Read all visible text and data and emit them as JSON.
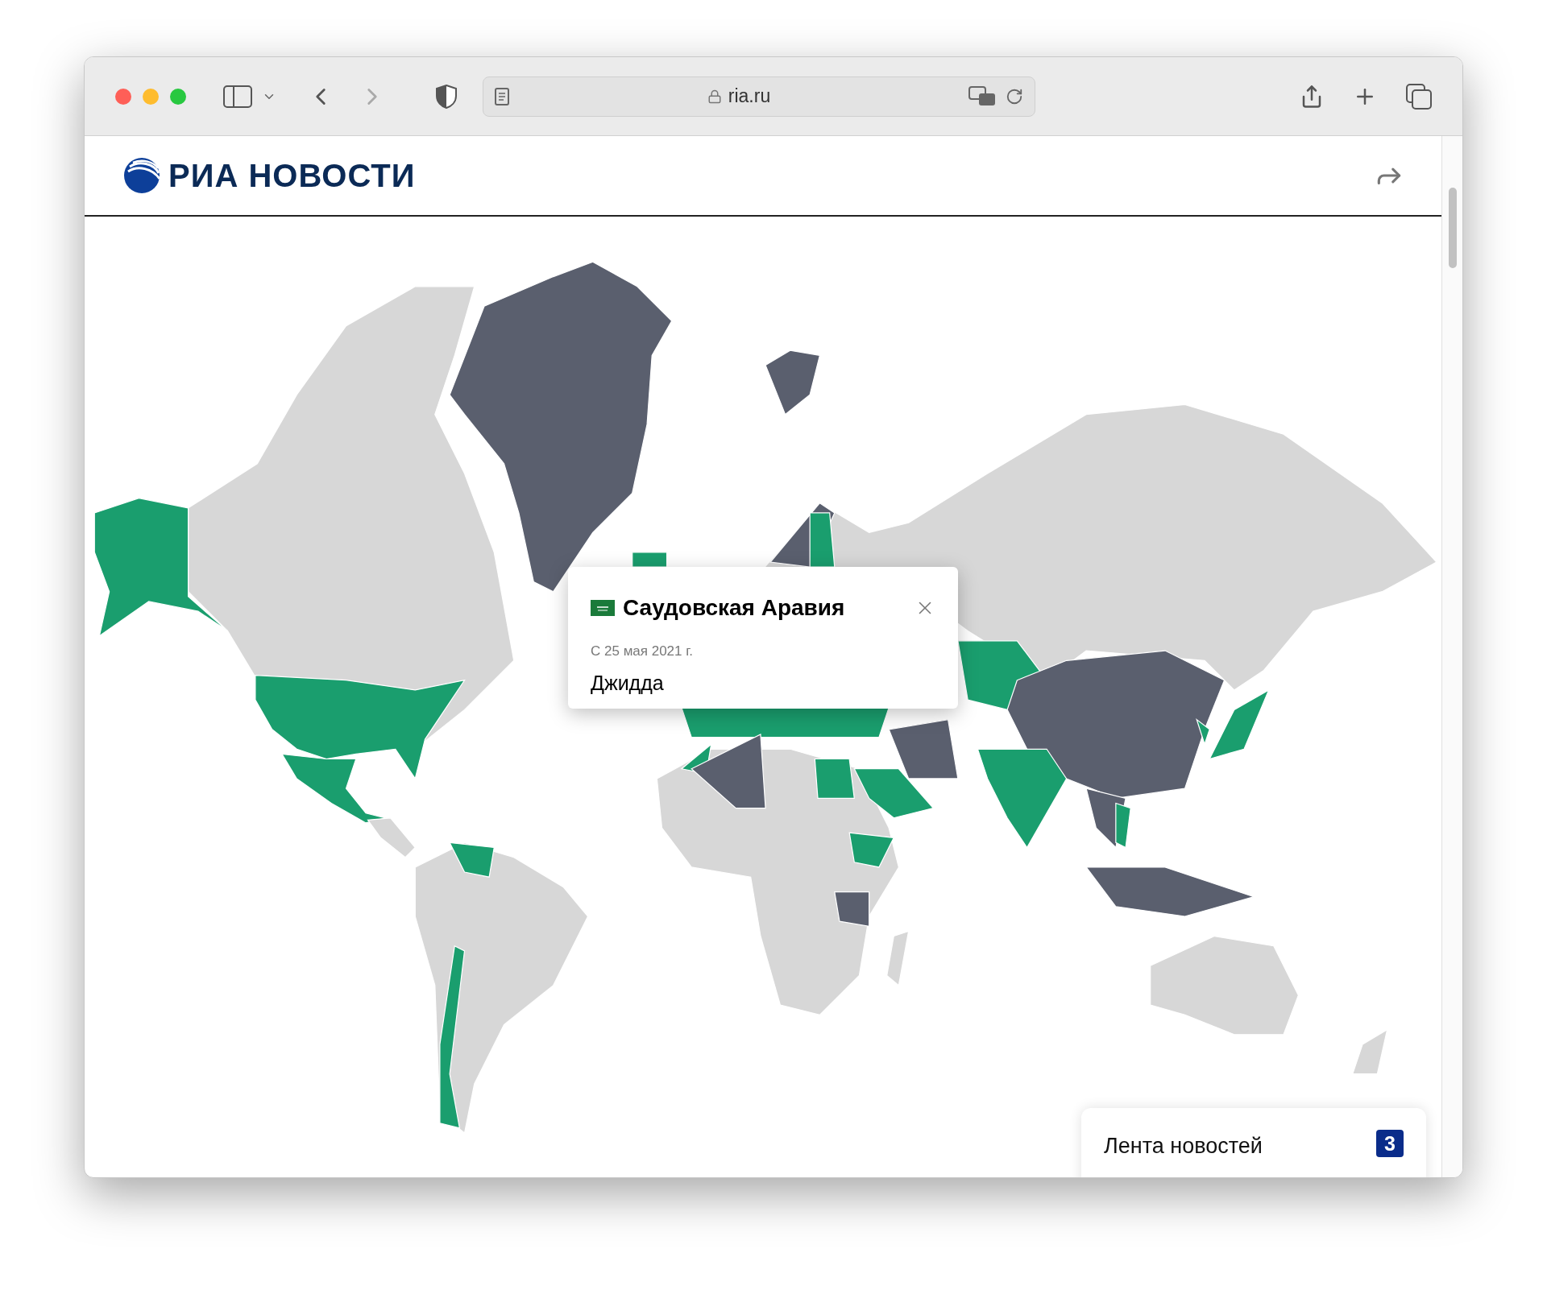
{
  "browser": {
    "url": "ria.ru"
  },
  "header": {
    "logo_text": "РИА НОВОСТИ"
  },
  "popup": {
    "title": "Саудовская Аравия",
    "date": "С 25 мая 2021 г.",
    "city": "Джидда"
  },
  "news_feed": {
    "label": "Лента новостей",
    "count": "3"
  }
}
